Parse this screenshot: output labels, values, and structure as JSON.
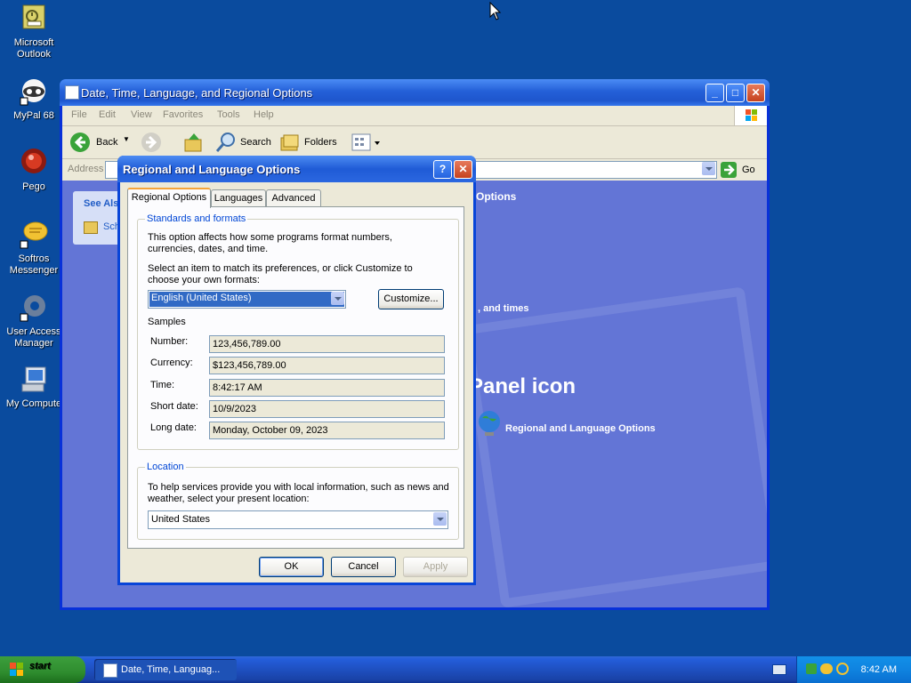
{
  "desktop": {
    "icons": [
      {
        "label": "Microsoft Outlook"
      },
      {
        "label": "MyPal 68"
      },
      {
        "label": "Pego"
      },
      {
        "label": "Softros Messenger"
      },
      {
        "label": "User Access Manager"
      },
      {
        "label": "My Compute"
      }
    ]
  },
  "explorer": {
    "title": "Date, Time, Language, and Regional Options",
    "menu": [
      "File",
      "Edit",
      "View",
      "Favorites",
      "Tools",
      "Help"
    ],
    "toolbar": {
      "back": "Back",
      "search": "Search",
      "folders": "Folders"
    },
    "address_label": "Address",
    "go_label": "Go",
    "see_also": "See Als",
    "see_also_item": "Sch",
    "fragments": {
      "options": "Options",
      "and_times": ", and times",
      "panel_icon": "Panel icon",
      "regional": "Regional and Language Options"
    }
  },
  "dialog": {
    "title": "Regional and Language Options",
    "help_btn": "?",
    "close_btn": "✕",
    "tabs": [
      "Regional Options",
      "Languages",
      "Advanced"
    ],
    "standards": {
      "legend": "Standards and formats",
      "desc": "This option affects how some programs format numbers, currencies, dates, and time.",
      "prompt": "Select an item to match its preferences, or click Customize to choose your own formats:",
      "selected": "English (United States)",
      "customize": "Customize...",
      "samples_label": "Samples",
      "samples": [
        {
          "label": "Number:",
          "value": "123,456,789.00"
        },
        {
          "label": "Currency:",
          "value": "$123,456,789.00"
        },
        {
          "label": "Time:",
          "value": "8:42:17 AM"
        },
        {
          "label": "Short date:",
          "value": "10/9/2023"
        },
        {
          "label": "Long date:",
          "value": "Monday, October 09, 2023"
        }
      ]
    },
    "location": {
      "legend": "Location",
      "desc": "To help services provide you with local information, such as news and weather, select your present location:",
      "selected": "United States"
    },
    "buttons": {
      "ok": "OK",
      "cancel": "Cancel",
      "apply": "Apply"
    }
  },
  "taskbar": {
    "start": "start",
    "item": "Date, Time, Languag...",
    "clock": "8:42 AM"
  },
  "colors": {
    "desktop": "#0a4b9e",
    "xp_blue": "#0845d8",
    "group_title": "#0046d5"
  }
}
